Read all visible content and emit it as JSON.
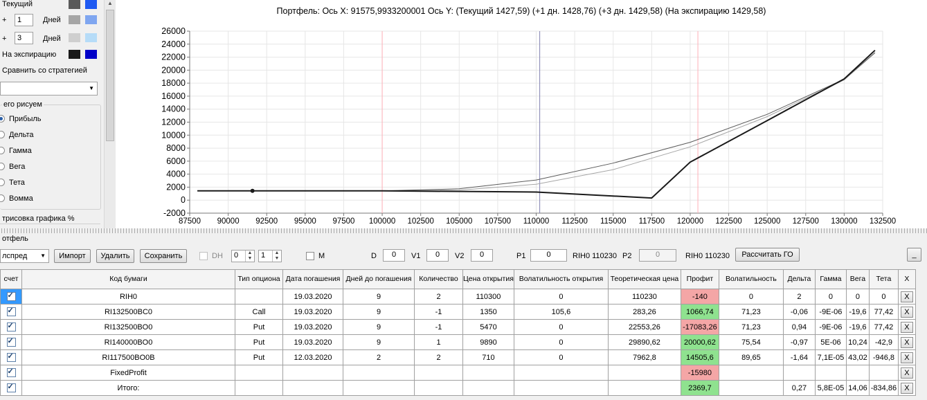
{
  "left_panel": {
    "rows": [
      {
        "label": "Текущий",
        "colors": [
          "#5a5a5a",
          "#1f5af2"
        ]
      },
      {
        "prefix": "+",
        "value": "1",
        "unit": "Дней",
        "colors": [
          "#a6a6a6",
          "#7fa6f0"
        ]
      },
      {
        "prefix": "+",
        "value": "3",
        "unit": "Дней",
        "colors": [
          "#cfcfcf",
          "#b6dcf8"
        ]
      },
      {
        "label": "На экспирацию",
        "colors": [
          "#1a1a1a",
          "#0000c8"
        ]
      }
    ],
    "compare_label": "Сравнить со стратегией",
    "group_label": "его рисуем",
    "radios": [
      "Прибыль",
      "Дельта",
      "Гамма",
      "Вега",
      "Тета",
      "Вомма"
    ],
    "selected_radio": "Прибыль",
    "render_label": "трисовка графика %"
  },
  "chart_title": "Портфель: Ось X: 91575,9933200001 Ось Y:  (Текущий 1427,59)  (+1 дн. 1428,76)  (+3 дн. 1429,58)  (На экспирацию 1429,58)",
  "chart_data": {
    "type": "line",
    "xlim": [
      87500,
      132500
    ],
    "ylim": [
      -2000,
      26000
    ],
    "x_ticks": [
      "87500",
      "90000",
      "92500",
      "95000",
      "97500",
      "100000",
      "102500",
      "105000",
      "107500",
      "110000",
      "112500",
      "115000",
      "117500",
      "120000",
      "122500",
      "125000",
      "127500",
      "130000",
      "132500"
    ],
    "y_ticks": [
      "-2000",
      "0",
      "2000",
      "4000",
      "6000",
      "8000",
      "10000",
      "12000",
      "14000",
      "16000",
      "18000",
      "20000",
      "22000",
      "24000",
      "26000"
    ],
    "vlines": [
      {
        "x": 100000,
        "color": "#ffb0b8"
      },
      {
        "x": 110230,
        "color": "#8080b0"
      },
      {
        "x": 120500,
        "color": "#ffb0b8"
      }
    ],
    "marker": {
      "x": 91576,
      "y": 1428
    },
    "grid": true,
    "series": [
      {
        "color": "#1a1a1a",
        "width": 2,
        "x": [
          88000,
          100000,
          110000,
          117500,
          120000,
          125000,
          130000,
          132000
        ],
        "y": [
          1430,
          1430,
          1250,
          330,
          5850,
          12250,
          18650,
          23050
        ]
      },
      {
        "color": "#5a5a5a",
        "width": 1,
        "x": [
          88000,
          100000,
          105000,
          110000,
          115000,
          120000,
          125000,
          130000,
          132000
        ],
        "y": [
          1430,
          1430,
          1750,
          3100,
          5700,
          8900,
          13200,
          18600,
          22700
        ]
      },
      {
        "color": "#a6a6a6",
        "width": 1,
        "x": [
          88000,
          100000,
          105000,
          110000,
          115000,
          120000,
          125000,
          130000,
          132000
        ],
        "y": [
          1430,
          1430,
          1550,
          2450,
          4700,
          8200,
          12850,
          18500,
          22650
        ]
      }
    ]
  },
  "portfolio_label": "отфель",
  "toolbar": {
    "combo_value": "лспред",
    "import": "Импорт",
    "delete": "Удалить",
    "save": "Сохранить",
    "dh": "DH",
    "spin1": "0",
    "spin2": "1",
    "m": "M",
    "d_label": "D",
    "d_val": "0",
    "v1_label": "V1",
    "v1_val": "0",
    "v2_label": "V2",
    "v2_val": "0",
    "p1_label": "P1",
    "p1_val": "0",
    "p1_sec": "RIH0 110230",
    "p2_label": "P2",
    "p2_val": "0",
    "p2_sec": "RIH0 110230",
    "calc": "Рассчитать ГО",
    "minimize": "_"
  },
  "table": {
    "columns": [
      "счет",
      "Код бумаги",
      "Тип опциона",
      "Дата погашения",
      "Дней до погашения",
      "Количество",
      "Цена открытия",
      "Волатильность открытия",
      "Теоретическая цена",
      "Профит",
      "Волатильность",
      "Дельта",
      "Гамма",
      "Вега",
      "Тета",
      "X"
    ],
    "rows": [
      {
        "code": "RIH0",
        "type": "",
        "date": "19.03.2020",
        "days": "9",
        "qty": "2",
        "open": "110300",
        "vol_open": "0",
        "theo": "110230",
        "profit": "-140",
        "vol": "0",
        "delta": "2",
        "gamma": "0",
        "vega": "0",
        "theta": "0",
        "profit_color": "#f4a6a6"
      },
      {
        "code": "RI132500BC0",
        "type": "Call",
        "date": "19.03.2020",
        "days": "9",
        "qty": "-1",
        "open": "1350",
        "vol_open": "105,6",
        "theo": "283,26",
        "profit": "1066,74",
        "vol": "71,23",
        "delta": "-0,06",
        "gamma": "-9E-06",
        "vega": "-19,6",
        "theta": "77,42",
        "profit_color": "#8fe28f"
      },
      {
        "code": "RI132500BO0",
        "type": "Put",
        "date": "19.03.2020",
        "days": "9",
        "qty": "-1",
        "open": "5470",
        "vol_open": "0",
        "theo": "22553,26",
        "profit": "-17083,26",
        "vol": "71,23",
        "delta": "0,94",
        "gamma": "-9E-06",
        "vega": "-19,6",
        "theta": "77,42",
        "profit_color": "#f4a6a6"
      },
      {
        "code": "RI140000BO0",
        "type": "Put",
        "date": "19.03.2020",
        "days": "9",
        "qty": "1",
        "open": "9890",
        "vol_open": "0",
        "theo": "29890,62",
        "profit": "20000,62",
        "vol": "75,54",
        "delta": "-0,97",
        "gamma": "5E-06",
        "vega": "10,24",
        "theta": "-42,9",
        "profit_color": "#8fe28f"
      },
      {
        "code": "RI117500BO0B",
        "type": "Put",
        "date": "12.03.2020",
        "days": "2",
        "qty": "2",
        "open": "710",
        "vol_open": "0",
        "theo": "7962,8",
        "profit": "14505,6",
        "vol": "89,65",
        "delta": "-1,64",
        "gamma": "7,1E-05",
        "vega": "43,02",
        "theta": "-946,8",
        "profit_color": "#8fe28f"
      },
      {
        "code": "FixedProfit",
        "type": "",
        "date": "",
        "days": "",
        "qty": "",
        "open": "",
        "vol_open": "",
        "theo": "",
        "profit": "-15980",
        "vol": "",
        "delta": "",
        "gamma": "",
        "vega": "",
        "theta": "",
        "profit_color": "#f4a6a6"
      },
      {
        "code": "Итого:",
        "type": "",
        "date": "",
        "days": "",
        "qty": "",
        "open": "",
        "vol_open": "",
        "theo": "",
        "profit": "2369,7",
        "vol": "",
        "delta": "0,27",
        "gamma": "5,8E-05",
        "vega": "14,06",
        "theta": "-834,86",
        "profit_color": "#8fe28f"
      }
    ],
    "x_label": "X"
  }
}
